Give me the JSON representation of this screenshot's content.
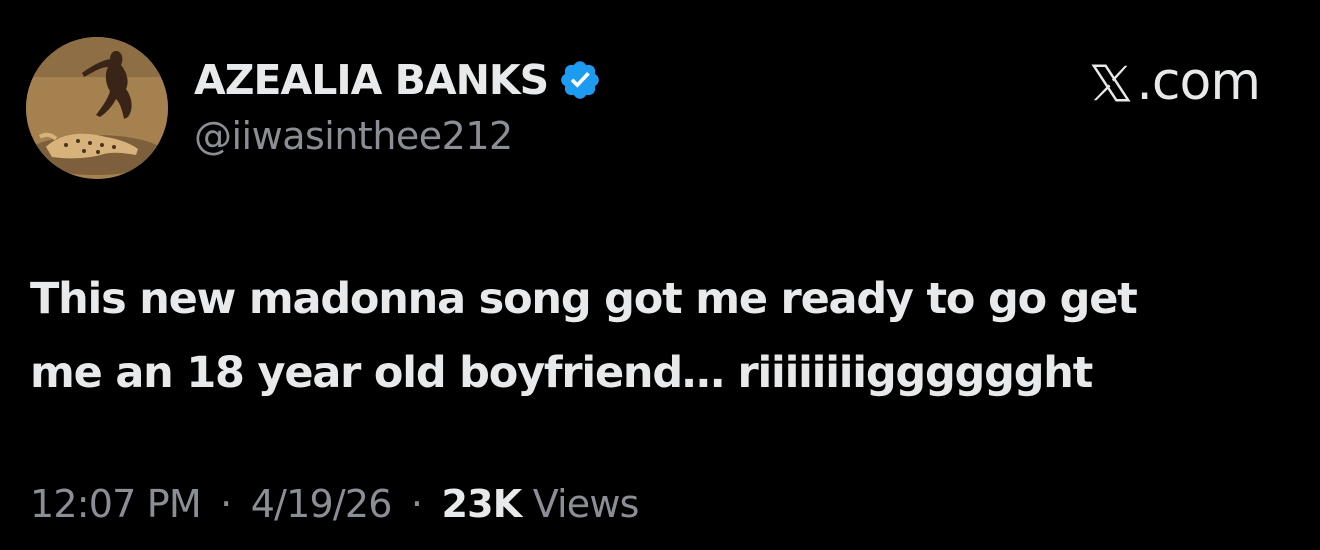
{
  "user": {
    "display_name": "AZEALIA BANKS",
    "handle": "@iiwasinthee212",
    "verified": true
  },
  "brand": {
    "suffix": ".com",
    "icon": "x-logo-icon"
  },
  "tweet": {
    "text_lines": [
      "This new madonna song got me ready to go get",
      "me an 18 year old boyfriend… riiiiiiiigggggght"
    ]
  },
  "meta": {
    "time": "12:07 PM",
    "separator": "·",
    "date": "4/19/26",
    "views_count": "23K",
    "views_label": "Views"
  },
  "colors": {
    "background": "#000000",
    "text_primary": "#e7e9ea",
    "text_secondary": "#8b8f95",
    "verified_blue": "#1d9bf0"
  }
}
